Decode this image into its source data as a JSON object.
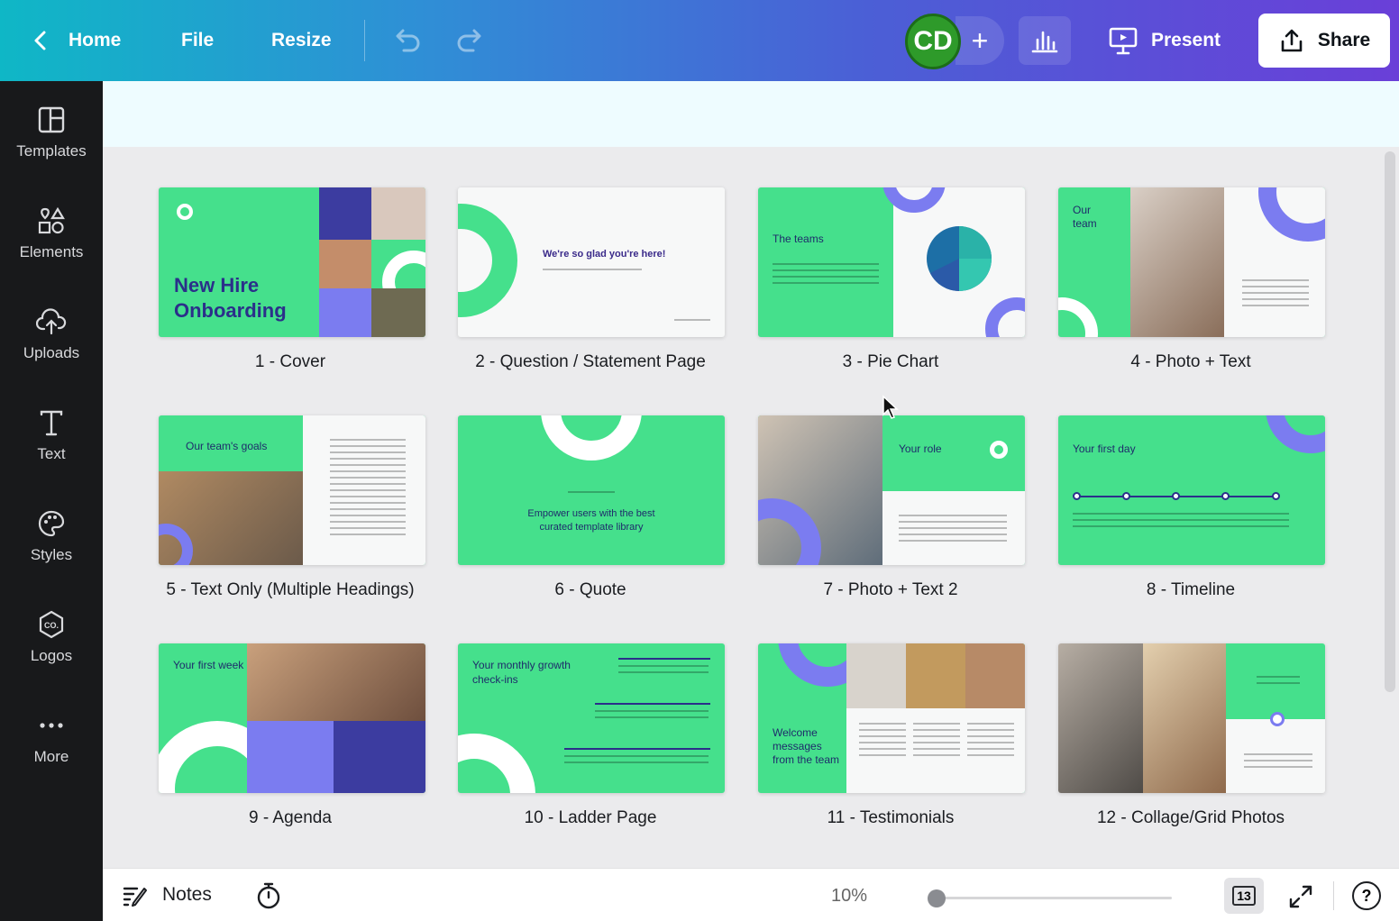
{
  "topbar": {
    "home": "Home",
    "file": "File",
    "resize": "Resize",
    "avatar_initials": "CD",
    "add_label": "+",
    "present": "Present",
    "share": "Share",
    "icons": [
      "chevron-left-icon",
      "undo-icon",
      "redo-icon",
      "bar-chart-icon",
      "present-icon",
      "share-upload-icon"
    ]
  },
  "sidebar": {
    "items": [
      {
        "label": "Templates",
        "icon": "templates-icon"
      },
      {
        "label": "Elements",
        "icon": "elements-icon"
      },
      {
        "label": "Uploads",
        "icon": "upload-cloud-icon"
      },
      {
        "label": "Text",
        "icon": "text-icon"
      },
      {
        "label": "Styles",
        "icon": "palette-icon"
      },
      {
        "label": "Logos",
        "icon": "logo-icon"
      },
      {
        "label": "More",
        "icon": "more-dots-icon"
      }
    ]
  },
  "pages": [
    {
      "caption": "1 - Cover",
      "title": "New Hire Onboarding"
    },
    {
      "caption": "2 - Question / Statement Page",
      "title": "We're so glad you're here!"
    },
    {
      "caption": "3 - Pie Chart",
      "title": "The teams"
    },
    {
      "caption": "4 - Photo + Text",
      "title": "Our team"
    },
    {
      "caption": "5 - Text Only (Multiple Headings)",
      "title": "Our team's goals"
    },
    {
      "caption": "6 - Quote",
      "title": "Empower users with the best curated template library"
    },
    {
      "caption": "7 - Photo + Text 2",
      "title": "Your role"
    },
    {
      "caption": "8 - Timeline",
      "title": "Your first day"
    },
    {
      "caption": "9 - Agenda",
      "title": "Your first week"
    },
    {
      "caption": "10 - Ladder Page",
      "title": "Your monthly growth check-ins"
    },
    {
      "caption": "11 - Testimonials",
      "title": "Welcome messages from the team"
    },
    {
      "caption": "12 - Collage/Grid Photos",
      "title": ""
    }
  ],
  "bottombar": {
    "notes": "Notes",
    "zoom": "10%",
    "zoom_level_percent": 10,
    "page_count": "13"
  },
  "colors": {
    "slide_green": "#45e08c",
    "accent_purple": "#7b7cf0",
    "navy": "#2b2f8a",
    "sidebar_bg": "#18191b"
  }
}
